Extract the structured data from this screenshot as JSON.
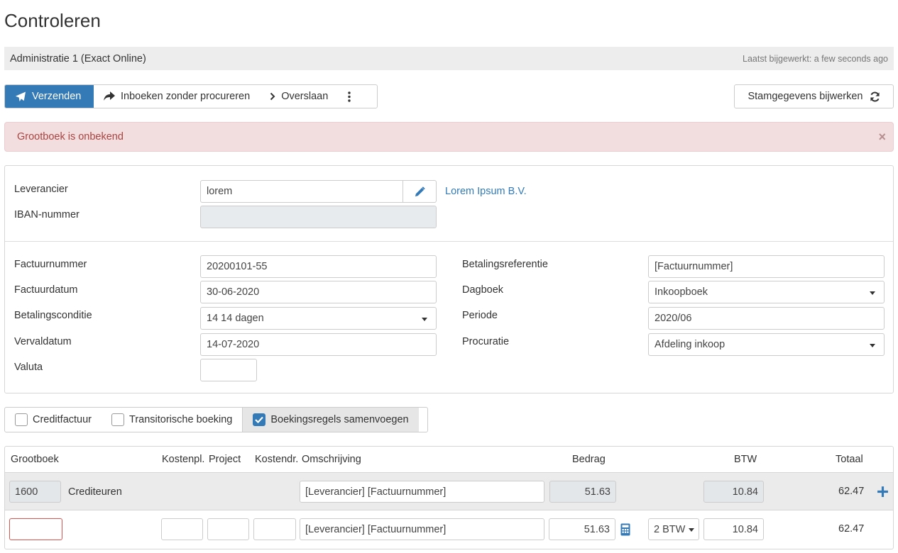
{
  "page_title": "Controleren",
  "admin": {
    "name": "Administratie 1 (Exact Online)",
    "updated": "Laatst bijgewerkt: a few seconds ago"
  },
  "toolbar": {
    "send_label": "Verzenden",
    "book_label": "Inboeken zonder procureren",
    "skip_label": "Overslaan",
    "update_master_label": "Stamgegevens bijwerken"
  },
  "alert": {
    "message": "Grootboek is onbekend",
    "close": "×"
  },
  "supplier": {
    "label": "Leverancier",
    "value": "lorem",
    "link": "Lorem Ipsum B.V.",
    "iban_label": "IBAN-nummer",
    "iban_value": ""
  },
  "invoice": {
    "number_label": "Factuurnummer",
    "number_value": "20200101-55",
    "date_label": "Factuurdatum",
    "date_value": "30-06-2020",
    "terms_label": "Betalingsconditie",
    "terms_value": "14 14 dagen",
    "due_label": "Vervaldatum",
    "due_value": "14-07-2020",
    "currency_label": "Valuta",
    "currency_value": "",
    "payref_label": "Betalingsreferentie",
    "payref_value": "[Factuurnummer]",
    "journal_label": "Dagboek",
    "journal_value": "Inkoopboek",
    "period_label": "Periode",
    "period_value": "2020/06",
    "procuration_label": "Procuratie",
    "procuration_value": "Afdeling inkoop"
  },
  "options": {
    "credit_label": "Creditfactuur",
    "credit_checked": false,
    "transitory_label": "Transitorische boeking",
    "transitory_checked": false,
    "merge_label": "Boekingsregels samenvoegen",
    "merge_checked": true
  },
  "table": {
    "headers": {
      "ledger": "Grootboek",
      "costcenter": "Kostenpl.",
      "project": "Project",
      "costunit": "Kostendr.",
      "description": "Omschrijving",
      "amount": "Bedrag",
      "vat": "BTW",
      "total": "Totaal"
    },
    "rows": [
      {
        "ledger_code": "1600",
        "ledger_name": "Crediteuren",
        "description": "[Leverancier] [Factuurnummer]",
        "amount": "51.63",
        "vat": "10.84",
        "total": "62.47"
      },
      {
        "ledger_code": "",
        "description": "[Leverancier] [Factuurnummer]",
        "amount": "51.63",
        "vat_code": "2 BTW",
        "vat": "10.84",
        "total": "62.47"
      }
    ]
  },
  "colors": {
    "primary": "#337ab7",
    "alert_bg": "#f2dede",
    "alert_text": "#a94442",
    "error_border": "#d9534f"
  }
}
